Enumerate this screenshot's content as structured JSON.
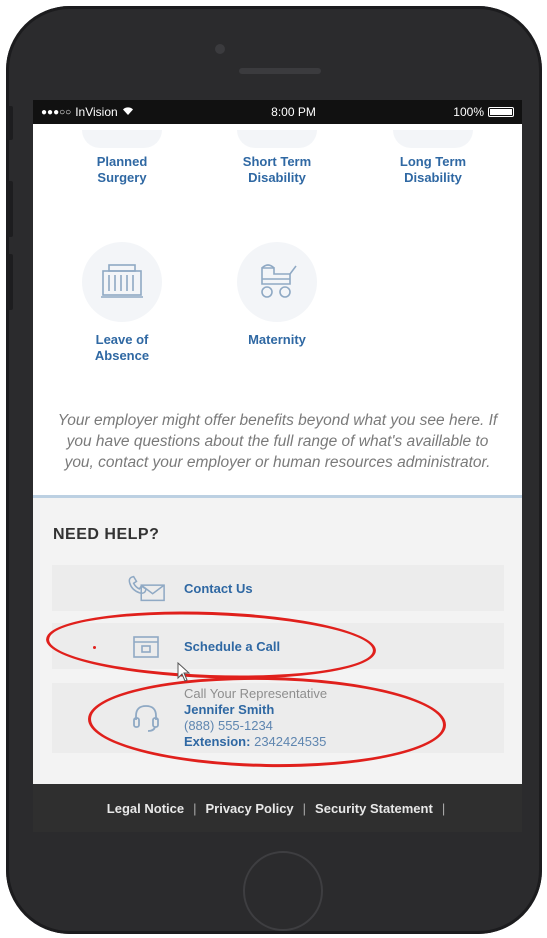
{
  "status_bar": {
    "carrier": "InVision",
    "time": "8:00 PM",
    "battery": "100%"
  },
  "benefits": [
    {
      "label_line1": "Planned",
      "label_line2": "Surgery"
    },
    {
      "label_line1": "Short Term",
      "label_line2": "Disability"
    },
    {
      "label_line1": "Long Term",
      "label_line2": "Disability"
    },
    {
      "label_line1": "Leave of",
      "label_line2": "Absence",
      "icon": "building-icon"
    },
    {
      "label_line1": "Maternity",
      "label_line2": "",
      "icon": "stroller-icon"
    }
  ],
  "disclaimer": "Your employer might offer benefits beyond what you see here. If you have questions about the full range of what's availlable to you, contact your employer or human resources administrator.",
  "help": {
    "title": "NEED HELP?",
    "contact_label": "Contact Us",
    "schedule_label": "Schedule a Call",
    "rep_caption": "Call Your Representative",
    "rep_name": "Jennifer Smith",
    "rep_phone": "(888) 555-1234",
    "rep_ext_label": "Extension:",
    "rep_ext_value": "2342424535"
  },
  "footer": {
    "links": [
      "Legal Notice",
      "Privacy Policy",
      "Security Statement"
    ]
  },
  "colors": {
    "link_blue": "#2f68a3",
    "annotation_red": "#e0201c",
    "phone_body": "#2b2b2d"
  }
}
